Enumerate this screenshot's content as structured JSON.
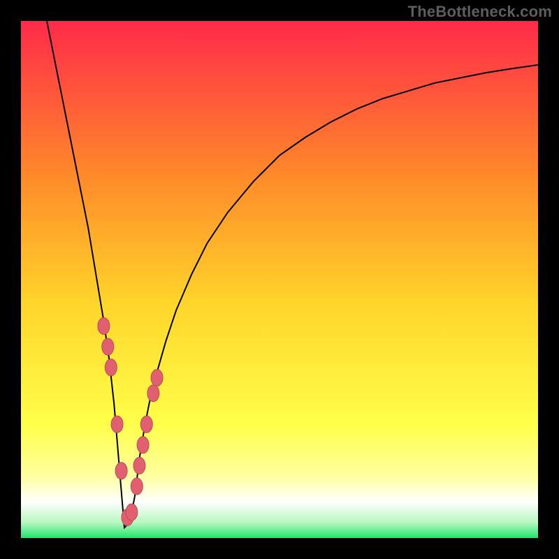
{
  "attribution": "TheBottleneck.com",
  "colors": {
    "top": "#ff2a4a",
    "mid1": "#ff8a2a",
    "mid2": "#ffd62a",
    "mid3": "#ffff4a",
    "pale": "#ffffa0",
    "white": "#ffffff",
    "green": "#1ee66a",
    "dot": "#e06070"
  },
  "chart_data": {
    "type": "line",
    "title": "",
    "xlabel": "",
    "ylabel": "",
    "ylim": [
      0,
      100
    ],
    "xlim": [
      0,
      100
    ],
    "x_minimum": 20,
    "series": [
      {
        "name": "bottleneck-curve",
        "x": [
          5,
          7,
          9,
          11,
          13,
          15,
          16,
          17,
          18,
          19,
          20,
          21,
          22,
          23,
          24,
          25,
          26,
          28,
          30,
          33,
          36,
          40,
          45,
          50,
          55,
          60,
          65,
          70,
          75,
          80,
          85,
          90,
          95,
          100
        ],
        "values": [
          100,
          90,
          80,
          70,
          60,
          48,
          42,
          35,
          26,
          14,
          2,
          3,
          8,
          16,
          22,
          27,
          31,
          38,
          44,
          51,
          57,
          63,
          69,
          74,
          77.5,
          80.5,
          83,
          85,
          86.5,
          88,
          89,
          90,
          90.8,
          91.5
        ]
      },
      {
        "name": "benchmark-points",
        "x": [
          16.0,
          16.8,
          17.4,
          18.6,
          19.4,
          20.6,
          21.4,
          22.4,
          22.9,
          23.6,
          24.3,
          25.6,
          26.3
        ],
        "values": [
          41,
          37,
          33,
          22,
          13,
          4,
          5,
          10,
          14,
          18,
          22,
          28,
          31
        ]
      }
    ]
  }
}
